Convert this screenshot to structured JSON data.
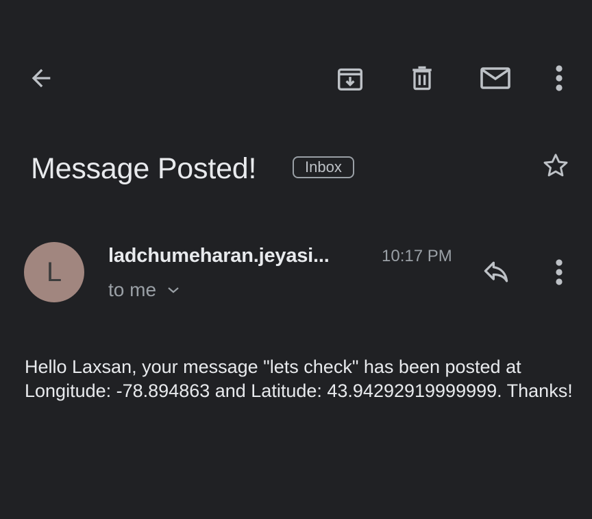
{
  "toolbar": {
    "back_icon": "arrow-left-icon",
    "archive_icon": "archive-icon",
    "delete_icon": "trash-icon",
    "mark_unread_icon": "mail-icon",
    "more_icon": "more-vert-icon"
  },
  "message": {
    "subject": "Message Posted!",
    "label": "Inbox",
    "star_icon": "star-outline-icon",
    "sender_initial": "L",
    "sender_name": "ladchumeharan.jeyasi...",
    "time": "10:17 PM",
    "recipient": "to me",
    "reply_icon": "reply-icon",
    "body": "Hello Laxsan, your message \"lets check\" has been posted at Longitude: -78.894863 and Latitude: 43.94292919999999. Thanks!"
  },
  "colors": {
    "background": "#202124",
    "text_primary": "#e8eaed",
    "text_secondary": "#9aa0a6",
    "avatar_bg": "#a1867f"
  }
}
